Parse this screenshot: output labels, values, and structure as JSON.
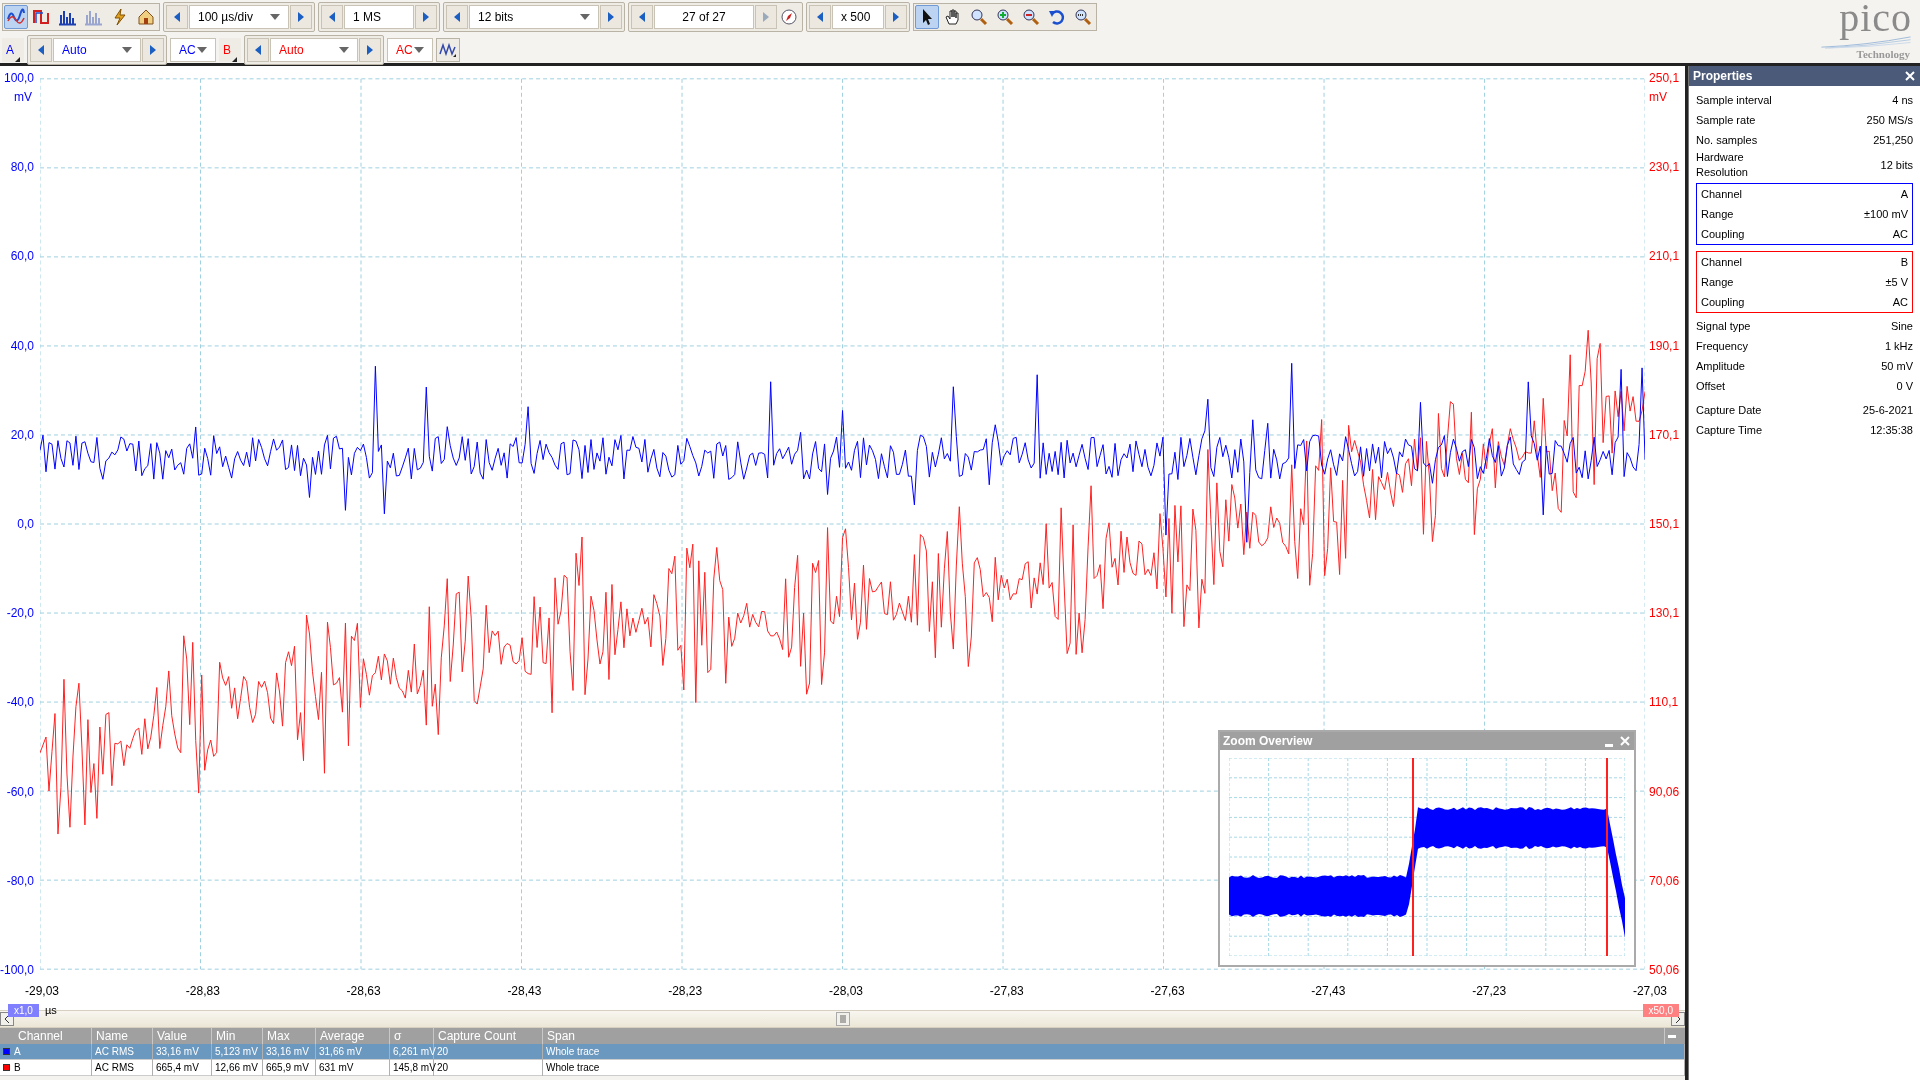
{
  "logo": {
    "name": "pico",
    "tagline": "Technology"
  },
  "toolbar": {
    "mode_buttons": [
      {
        "kind": "scope",
        "selected": true
      },
      {
        "kind": "persistence",
        "selected": false
      },
      {
        "kind": "spectrum",
        "selected": false
      },
      {
        "kind": "spectrum",
        "selected": false,
        "disabled": true
      },
      {
        "kind": "trigger",
        "selected": false
      },
      {
        "kind": "home",
        "selected": false
      }
    ],
    "timebase": "100 µs/div",
    "samples": "1 MS",
    "resolution": "12 bits",
    "capture": "27 of 27",
    "zoom_factor": "x 500",
    "tools": [
      {
        "kind": "pointer",
        "selected": true
      },
      {
        "kind": "hand",
        "selected": false
      },
      {
        "kind": "zoom",
        "selected": false
      },
      {
        "kind": "zoom_in",
        "selected": false
      },
      {
        "kind": "zoom_out",
        "selected": false
      },
      {
        "kind": "undo",
        "selected": false
      },
      {
        "kind": "zoom_fit",
        "selected": false
      }
    ]
  },
  "channels": [
    {
      "label": "A",
      "range": "Auto",
      "coupling": "AC",
      "color": "#0000ff"
    },
    {
      "label": "B",
      "range": "Auto",
      "coupling": "AC",
      "color": "#ff0000"
    }
  ],
  "plot": {
    "left_axis": {
      "unit": "mV",
      "labels": [
        "100,0",
        "80,0",
        "60,0",
        "40,0",
        "20,0",
        "0,0",
        "-20,0",
        "-40,0",
        "-60,0",
        "-80,0",
        "-100,0"
      ]
    },
    "right_axis": {
      "unit": "mV",
      "labels": [
        "250,1",
        "230,1",
        "210,1",
        "190,1",
        "170,1",
        "150,1",
        "130,1",
        "110,1",
        "90,06",
        "70,06",
        "50,06"
      ]
    },
    "x_axis": {
      "unit": "µs",
      "labels": [
        "-29,03",
        "-28,83",
        "-28,63",
        "-28,43",
        "-28,23",
        "-28,03",
        "-27,83",
        "-27,63",
        "-27,43",
        "-27,23",
        "-27,03"
      ],
      "left_scale": "x1,0",
      "right_scale": "x50,0"
    }
  },
  "zoom_overview": {
    "title": "Zoom Overview"
  },
  "properties": {
    "title": "Properties",
    "general": [
      {
        "label": "Sample interval",
        "value": "4 ns"
      },
      {
        "label": "Sample rate",
        "value": "250 MS/s"
      },
      {
        "label": "No. samples",
        "value": "251,250"
      },
      {
        "label": "Hardware Resolution",
        "value": "12 bits"
      }
    ],
    "channel_groups": [
      {
        "color": "#0000ff",
        "rows": [
          {
            "label": "Channel",
            "value": "A"
          },
          {
            "label": "Range",
            "value": "±100 mV"
          },
          {
            "label": "Coupling",
            "value": "AC"
          }
        ]
      },
      {
        "color": "#ff0000",
        "rows": [
          {
            "label": "Channel",
            "value": "B"
          },
          {
            "label": "Range",
            "value": "±5 V"
          },
          {
            "label": "Coupling",
            "value": "AC"
          }
        ]
      }
    ],
    "signal": [
      {
        "label": "Signal type",
        "value": "Sine"
      },
      {
        "label": "Frequency",
        "value": "1 kHz"
      },
      {
        "label": "Amplitude",
        "value": "50 mV"
      },
      {
        "label": "Offset",
        "value": "0 V"
      }
    ],
    "capture": [
      {
        "label": "Capture Date",
        "value": "25-6-2021"
      },
      {
        "label": "Capture Time",
        "value": "12:35:38"
      }
    ]
  },
  "measurements": {
    "columns": [
      "Channel",
      "Name",
      "Value",
      "Min",
      "Max",
      "Average",
      "σ",
      "Capture Count",
      "Span"
    ],
    "rows": [
      {
        "color": "#0000ff",
        "selected": true,
        "cells": [
          "A",
          "AC RMS",
          "33,16 mV",
          "5,123 mV",
          "33,16 mV",
          "31,66 mV",
          "6,261 mV",
          "20",
          "Whole trace"
        ]
      },
      {
        "color": "#ff0000",
        "selected": false,
        "cells": [
          "B",
          "AC RMS",
          "665,4 mV",
          "12,66 mV",
          "665,9 mV",
          "631 mV",
          "145,8 mV",
          "20",
          "Whole trace"
        ]
      }
    ]
  }
}
